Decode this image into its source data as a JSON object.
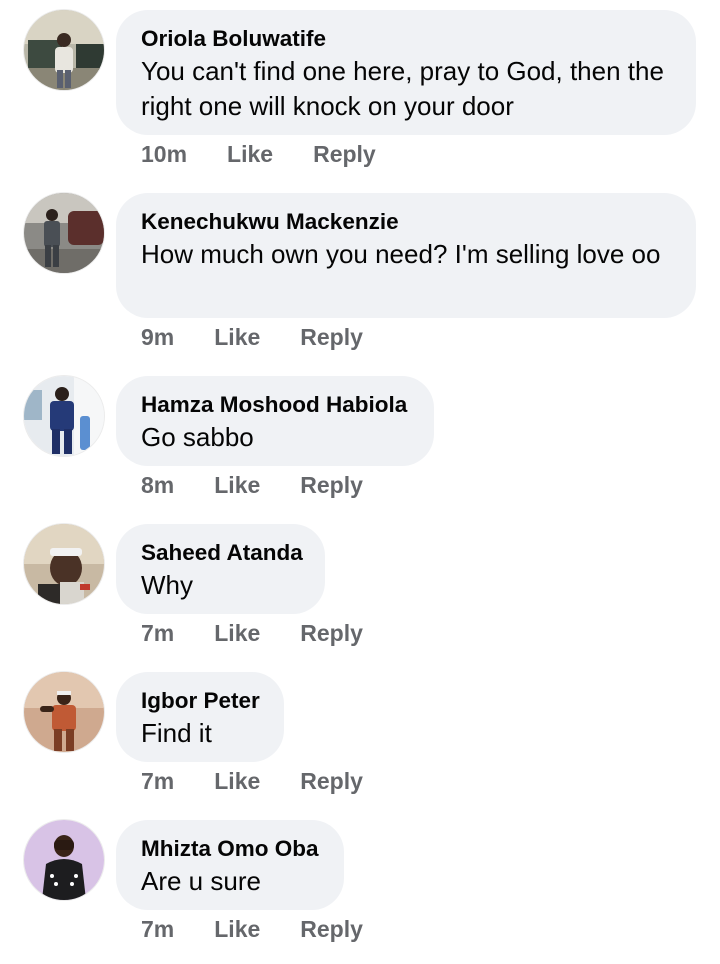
{
  "comments": [
    {
      "author": "Oriola Boluwatife",
      "text": "You can't find one here, pray to God, then the right one will knock on your door",
      "time": "10m",
      "like_label": "Like",
      "reply_label": "Reply"
    },
    {
      "author": "Kenechukwu Mackenzie",
      "text": "How much own you need? I'm selling love oo",
      "time": "9m",
      "like_label": "Like",
      "reply_label": "Reply"
    },
    {
      "author": "Hamza Moshood Habiola",
      "text": "Go sabbo",
      "time": "8m",
      "like_label": "Like",
      "reply_label": "Reply"
    },
    {
      "author": "Saheed Atanda",
      "text": "Why",
      "time": "7m",
      "like_label": "Like",
      "reply_label": "Reply"
    },
    {
      "author": "Igbor Peter",
      "text": "Find it",
      "time": "7m",
      "like_label": "Like",
      "reply_label": "Reply"
    },
    {
      "author": "Mhizta Omo Oba",
      "text": "Are u sure",
      "time": "7m",
      "like_label": "Like",
      "reply_label": "Reply"
    }
  ],
  "colors": {
    "bubble_bg": "#f0f2f5",
    "text": "#050505",
    "meta": "#65676b"
  }
}
